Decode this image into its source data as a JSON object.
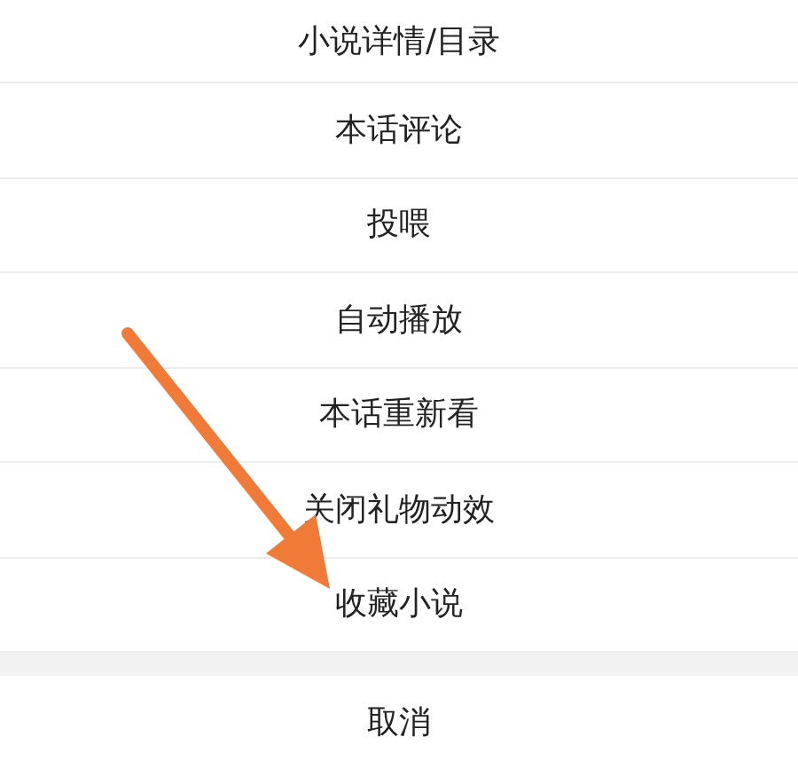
{
  "menu_items": [
    {
      "label": "小说详情/目录"
    },
    {
      "label": "本话评论"
    },
    {
      "label": "投喂"
    },
    {
      "label": "自动播放"
    },
    {
      "label": "本话重新看"
    },
    {
      "label": "关闭礼物动效"
    },
    {
      "label": "收藏小说"
    }
  ],
  "cancel_button": {
    "label": "取消"
  }
}
